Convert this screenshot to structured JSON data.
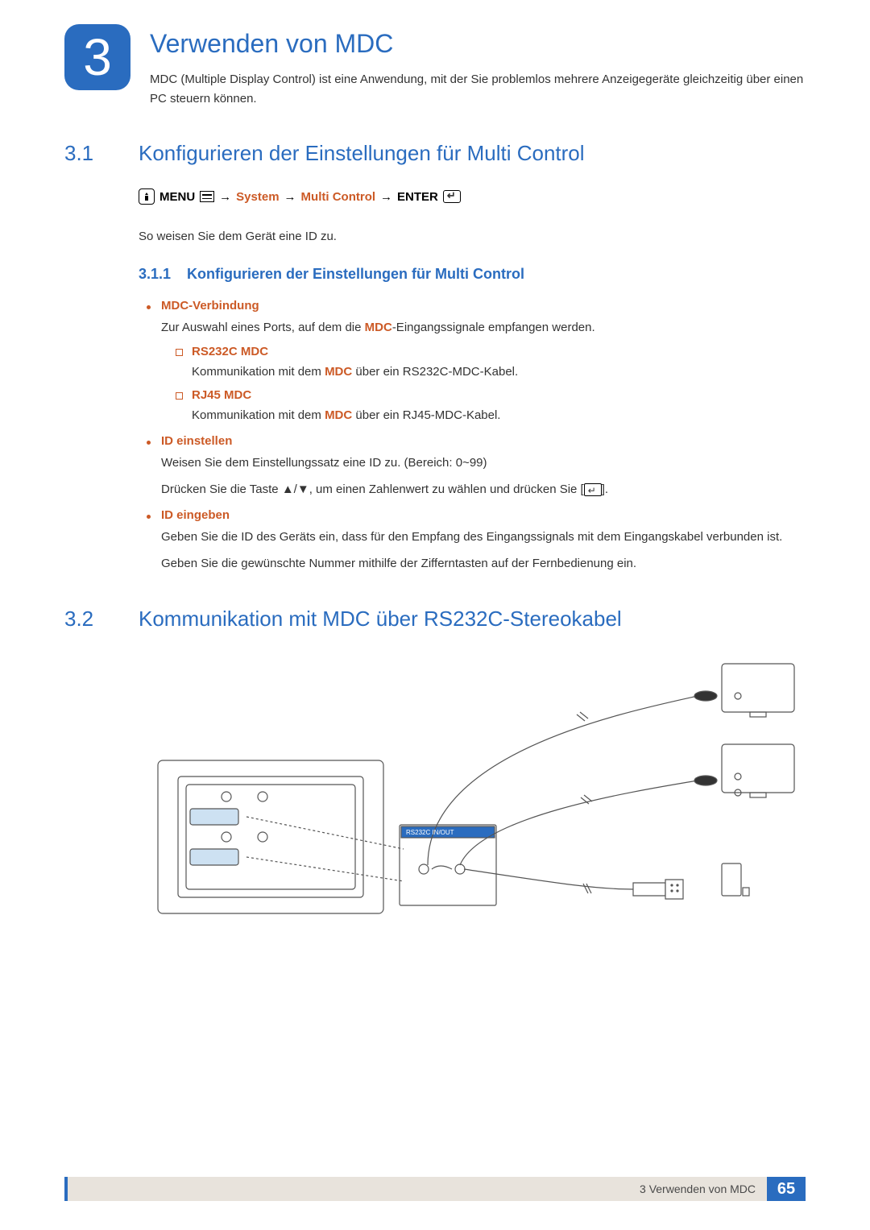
{
  "chapter": {
    "number": "3",
    "title": "Verwenden von MDC",
    "intro": "MDC (Multiple Display Control) ist eine Anwendung, mit der Sie problemlos mehrere Anzeigegeräte gleichzeitig über einen PC steuern können."
  },
  "section1": {
    "num": "3.1",
    "title": "Konfigurieren der Einstellungen für Multi Control",
    "menu_path": {
      "menu": "MENU",
      "system": "System",
      "multi_control": "Multi Control",
      "enter": "ENTER"
    },
    "intro_text": "So weisen Sie dem Gerät eine ID zu.",
    "sub1": {
      "num": "3.1.1",
      "title": "Konfigurieren der Einstellungen für Multi Control"
    },
    "bullets": {
      "mdc_conn": {
        "title": "MDC-Verbindung",
        "text_pre": "Zur Auswahl eines Ports, auf dem die ",
        "text_bold": "MDC",
        "text_post": "-Eingangssignale empfangen werden.",
        "rs232c": {
          "title": "RS232C MDC",
          "text_pre": "Kommunikation mit dem ",
          "text_bold": "MDC",
          "text_post": " über ein RS232C-MDC-Kabel."
        },
        "rj45": {
          "title": "RJ45 MDC",
          "text_pre": "Kommunikation mit dem ",
          "text_bold": "MDC",
          "text_post": " über ein RJ45-MDC-Kabel."
        }
      },
      "id_set": {
        "title": "ID einstellen",
        "line1": "Weisen Sie dem Einstellungssatz eine ID zu. (Bereich: 0~99)",
        "line2_pre": "Drücken Sie die Taste ",
        "line2_arrows": "▲/▼",
        "line2_mid": ", um einen Zahlenwert zu wählen und drücken Sie [",
        "line2_post": "]."
      },
      "id_enter": {
        "title": "ID eingeben",
        "line1": "Geben Sie die ID des Geräts ein, dass für den Empfang des Eingangssignals mit dem Eingangskabel verbunden ist.",
        "line2": "Geben Sie die gewünschte Nummer mithilfe der Zifferntasten auf der Fernbedienung ein."
      }
    }
  },
  "section2": {
    "num": "3.2",
    "title": "Kommunikation mit MDC über RS232C-Stereokabel"
  },
  "diagram": {
    "port_label": "RS232C IN/OUT"
  },
  "footer": {
    "text": "3 Verwenden von MDC",
    "page": "65"
  }
}
